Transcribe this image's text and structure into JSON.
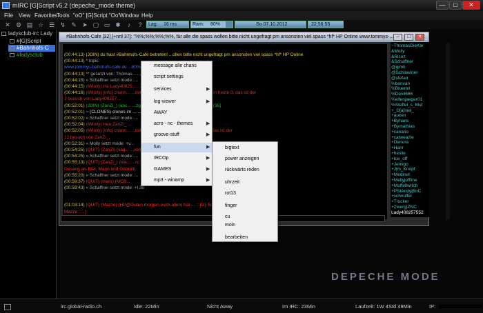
{
  "window": {
    "title": "mIRC [G]Script v5.2 (depeche_mode theme)",
    "min": "—",
    "max": "□",
    "close": "✕"
  },
  "menubar": [
    "File",
    "View",
    "Favorites",
    "Tools",
    "\"oO\" [G]Script \"Oo\"",
    "Window",
    "Help"
  ],
  "toolbar": {
    "lag_label": "Lag:",
    "lag_value": "16 ms",
    "ram_label": "Ram:",
    "ram_value": "80%",
    "date": "So  07.10.2012",
    "time": "22:56:55"
  },
  "tree": {
    "server": "ladysclub-irc Lady",
    "items": [
      "#[G]Script",
      "#Bahnhofs-C",
      "#ladysclub"
    ]
  },
  "channel": {
    "title": "#Bahnhofs-Cafe [32] [+nrtl 37]: \"%%;%%;%%;%%, für alle die spass wollen bitte nicht ungefragt pm ansonsten viel spass *hf* HP Online  www.tommys-..."
  },
  "messages": [
    {
      "ts": "(00:44:13)",
      "text": "(JOIN) du hast #Bahnhofs-Cafe betreten!   ...ollen bitte nicht ungefragt pm ansonsten viel spass *hf*  HP Online",
      "color": "#e8d23a"
    },
    {
      "ts": "(00:44:13)",
      "text": "* topic:",
      "color": "#aaa"
    },
    {
      "ts": "",
      "text": "www.tommys-bahnhofs-cafe.de  ...80%...",
      "color": "#4a6de0"
    },
    {
      "ts": "(00:44:13)",
      "text": "** gesetzt von: Thomas...  ...am: 10:14 uhr",
      "color": "#aaa"
    },
    {
      "ts": "(00:44:15)",
      "text": "» Schaffner setzt mode:  ...",
      "color": "#aaa"
    },
    {
      "ts": "(00:44:15)",
      "text": "(6Molly) Ha Lady40825...  ...ten.",
      "color": "#c33"
    },
    {
      "ts": "(00:44:16)",
      "text": "(6Molly) [info] chann...  ...det 16.09.2012 um 21:58:27 I 911, davon heute 3, das ist der",
      "color": "#c33"
    },
    {
      "ts": "",
      "text": "3 besuch von Lady408257...",
      "color": "#c33"
    },
    {
      "ts": "(00:52:01)",
      "text": "(JOIN) (ZanZi_) (anc...  ...zggo.nl) hat #Bahnhofs-Cafe betreten! [36]",
      "color": "#2db82d"
    },
    {
      "ts": "(00:52:01)",
      "text": "~ (CLONES) clones im ...  ..._ und ZanZi sind clones!",
      "color": "#ddd"
    },
    {
      "ts": "(00:52:02)",
      "text": "» Schaffner setzt mode:  ...",
      "color": "#aaa"
    },
    {
      "ts": "(00:52:04)",
      "text": "(6Molly) Heu ZanZi_ ...",
      "color": "#c33"
    },
    {
      "ts": "(00:52:05)",
      "text": "(6Molly) [info] chann...  ...det um 21:58:27 I 911, davon heute 4, das ist der",
      "color": "#c33"
    },
    {
      "ts": "",
      "text": "12 besuch von ZanZi_,",
      "color": "#c33"
    },
    {
      "ts": "(00:52:31)",
      "text": "» Molly setzt mode: +v...",
      "color": "#aaa"
    },
    {
      "ts": "(00:54:25)",
      "text": "(QUIT) (ZanZi) (sag...  ...verlassen! (Ping timeout)",
      "color": "#e33"
    },
    {
      "ts": "(00:54:25)",
      "text": "» Schaffner setzt mode:  ...",
      "color": "#aaa"
    },
    {
      "ts": "(00:55:13)",
      "text": "(QUIT) (ZanZi_) (ma...  ...rc verlassen! (Quit: Lieber Wein, Weib und",
      "color": "#e33"
    },
    {
      "ts": "",
      "text": "Gesang als Bier, Mann und Gebrüll)",
      "color": "#e33"
    },
    {
      "ts": "(00:55:20)",
      "text": "» Schaffner setzt mode:  ...",
      "color": "#aaa"
    },
    {
      "ts": "(00:59:37)",
      "text": "(QUIT) (mars) (MCB...",
      "color": "#e33"
    },
    {
      "ts": "(00:59:43)",
      "text": "» Schaffner setzt mode: +l 38",
      "color": "#aaa"
    },
    {
      "ts": "(01:03:14)",
      "text": "(QUIT) (Mazze) (HP@Guten.morgen.euch.allen) hat ...  :::[G]-Script vers.0.0:::...:::Redacted by",
      "color": "#e33"
    },
    {
      "ts": "",
      "text": "Mazze:::...)",
      "color": "#e33"
    },
    {
      "ts": "(01:03:20)",
      "text": "» Schaffner setzt mode: +l 37",
      "color": "#aaa"
    }
  ],
  "nicks": [
    "~ThomasDieKle",
    "&Molly",
    "&Ricoz",
    "&Schaffner",
    "@gimli",
    "@Schlawiner",
    "@stefan",
    "%berivan",
    "%Bluemli",
    "%Devil666",
    "%elfenjaeger01",
    "%Steffel_s_Mut",
    "+_D[a]niel_",
    "+auxen",
    "+Byhans",
    "+Bymathias",
    "+canario",
    "+catweazle",
    "+Denora",
    "+Hanr",
    "+heslie",
    "+Ice_off",
    "+Jemigo",
    "+Jim_Knopf",
    "+Medinet",
    "+Mellyjoffline",
    "+MuffelIwItch",
    "+PSIAndy|BnC",
    "+schnuffel",
    "+Trucker",
    "+Zwerg|ZNC",
    "Lady408257552"
  ],
  "context_menu": [
    "message alle chans",
    "script settings",
    "services",
    "log-viewer",
    "AWAY",
    "acro - nc - themes",
    "groove-stuff",
    "fun",
    "IRCOp",
    "GAMES",
    "mp3 - winamp"
  ],
  "fun_submenu": [
    "bigtext",
    "power anzeigen",
    "rückwärts reden",
    "uhrzeit",
    "rot13",
    "finger",
    "cu",
    "moin",
    "bearbeiten"
  ],
  "logo": "DEPECHE MODE",
  "status": {
    "server": "irc.global-radio.ch",
    "idle": "Idle: 22Min",
    "away": "Nicht Away",
    "im_irc": "Im IRC: 23Min",
    "laufzeit": "Laufzeit: 1W 4Std 49Min",
    "ip": "IP:"
  }
}
